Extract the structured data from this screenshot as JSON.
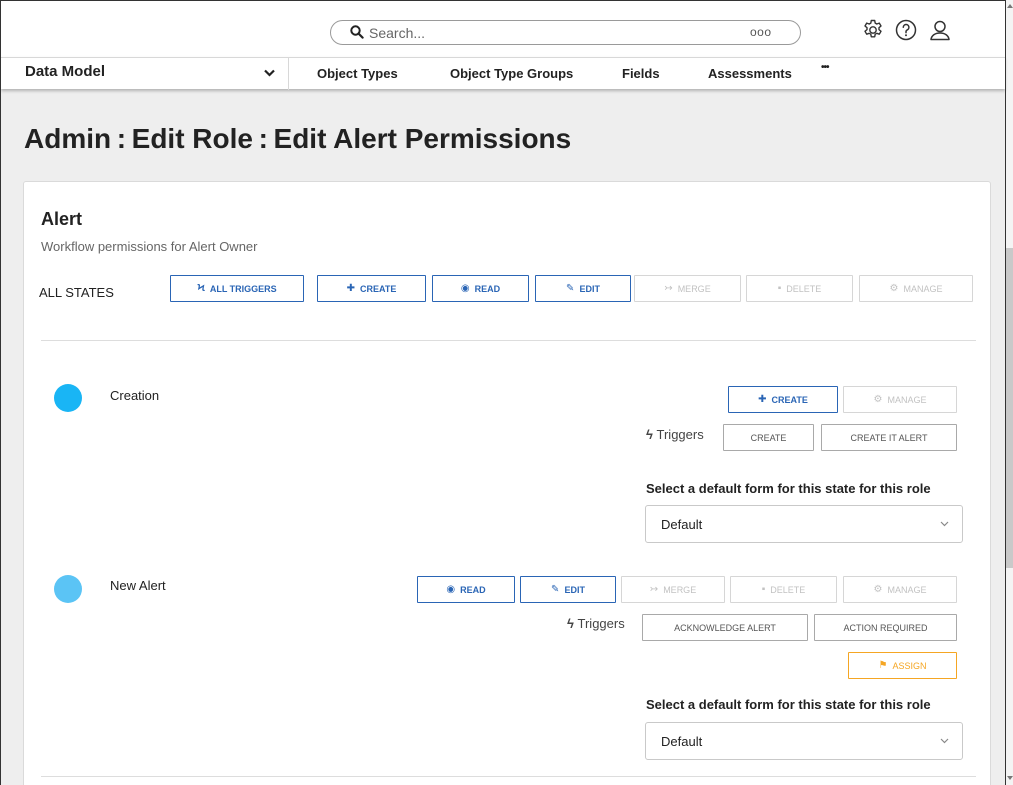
{
  "topbar": {
    "search_placeholder": "Search...",
    "search_more_label": "ooo",
    "icons": [
      "gear-icon",
      "help-icon",
      "user-icon"
    ]
  },
  "nav": {
    "module": "Data Model",
    "items": [
      {
        "label": "Object Types"
      },
      {
        "label": "Object Type Groups"
      },
      {
        "label": "Fields"
      },
      {
        "label": "Assessments"
      },
      {
        "label": "•••"
      }
    ]
  },
  "page": {
    "title": "Admin : Edit Role : Edit Alert Permissions"
  },
  "alert": {
    "title": "Alert",
    "subtitle": "Workflow permissions for Alert Owner",
    "all_states_label": "ALL STATES",
    "all_states_buttons": [
      {
        "icon": "bolt-icon",
        "glyph": "ϟ",
        "label": "ALL TRIGGERS",
        "enabled": true
      },
      {
        "icon": "plus-icon",
        "glyph": "✚",
        "label": "CREATE",
        "enabled": true
      },
      {
        "icon": "eye-icon",
        "glyph": "◉",
        "label": "READ",
        "enabled": true
      },
      {
        "icon": "pencil-icon",
        "glyph": "✎",
        "label": "EDIT",
        "enabled": true
      },
      {
        "icon": "merge-icon",
        "glyph": "↣",
        "label": "MERGE",
        "enabled": false
      },
      {
        "icon": "trash-icon",
        "glyph": "▪",
        "label": "DELETE",
        "enabled": false
      },
      {
        "icon": "gear-icon",
        "glyph": "⚙",
        "label": "MANAGE",
        "enabled": false
      }
    ]
  },
  "states": [
    {
      "name": "Creation",
      "color": "#19b5f5",
      "buttons": [
        {
          "label": "CREATE",
          "glyph": "✚",
          "enabled": true
        },
        {
          "label": "MANAGE",
          "glyph": "⚙",
          "enabled": false
        }
      ],
      "triggers_label": "Triggers",
      "triggers": [
        "CREATE",
        "CREATE IT ALERT"
      ],
      "form_label": "Select a default form for this state for this role",
      "form_value": "Default"
    },
    {
      "name": "New Alert",
      "color": "#5bc4f5",
      "buttons": [
        {
          "label": "READ",
          "glyph": "◉",
          "enabled": true
        },
        {
          "label": "EDIT",
          "glyph": "✎",
          "enabled": true
        },
        {
          "label": "MERGE",
          "glyph": "↣",
          "enabled": false
        },
        {
          "label": "DELETE",
          "glyph": "▪",
          "enabled": false
        },
        {
          "label": "MANAGE",
          "glyph": "⚙",
          "enabled": false
        }
      ],
      "triggers_label": "Triggers",
      "triggers": [
        "ACKNOWLEDGE ALERT",
        "ACTION REQUIRED"
      ],
      "assign": {
        "label": "ASSIGN",
        "glyph": "⚑"
      },
      "form_label": "Select a default form for this state for this role",
      "form_value": "Default"
    }
  ],
  "colors": {
    "primary": "#2a65b5",
    "disabled": "#d6d6d6",
    "accent_orange": "#f5a623",
    "page_bg": "#eeeeee"
  }
}
